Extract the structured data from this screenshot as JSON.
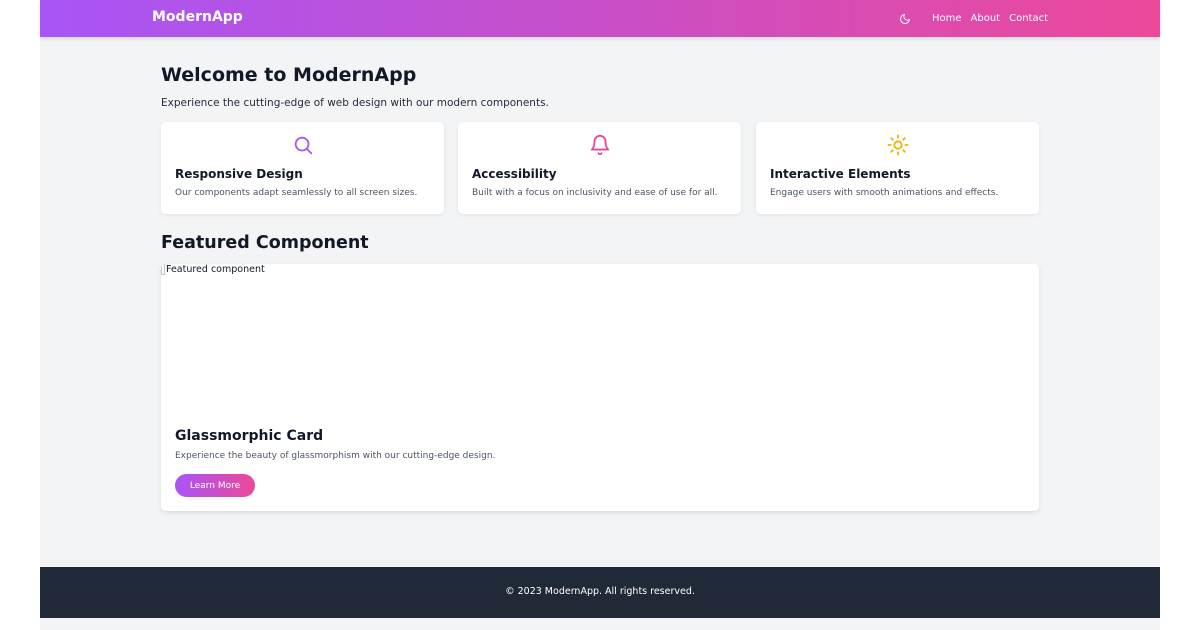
{
  "header": {
    "brand": "ModernApp",
    "theme_toggle_icon": "moon-icon",
    "nav": [
      {
        "label": "Home"
      },
      {
        "label": "About"
      },
      {
        "label": "Contact"
      }
    ]
  },
  "hero": {
    "title": "Welcome to ModernApp",
    "intro": "Experience the cutting-edge of web design with our modern components."
  },
  "features": [
    {
      "icon": "search-icon",
      "icon_color": "#a855f7",
      "title": "Responsive Design",
      "description": "Our components adapt seamlessly to all screen sizes."
    },
    {
      "icon": "bell-icon",
      "icon_color": "#ec4899",
      "title": "Accessibility",
      "description": "Built with a focus on inclusivity and ease of use for all."
    },
    {
      "icon": "sun-icon",
      "icon_color": "#eab308",
      "title": "Interactive Elements",
      "description": "Engage users with smooth animations and effects."
    }
  ],
  "featured": {
    "heading": "Featured Component",
    "image_alt": "Featured component",
    "title": "Glassmorphic Card",
    "description": "Experience the beauty of glassmorphism with our cutting-edge design.",
    "button_label": "Learn More"
  },
  "footer": {
    "copyright": "© 2023 ModernApp. All rights reserved."
  },
  "colors": {
    "gradient_start": "#a855f7",
    "gradient_end": "#ec4899",
    "footer_bg": "#1f2937",
    "page_bg": "#f3f4f6"
  }
}
